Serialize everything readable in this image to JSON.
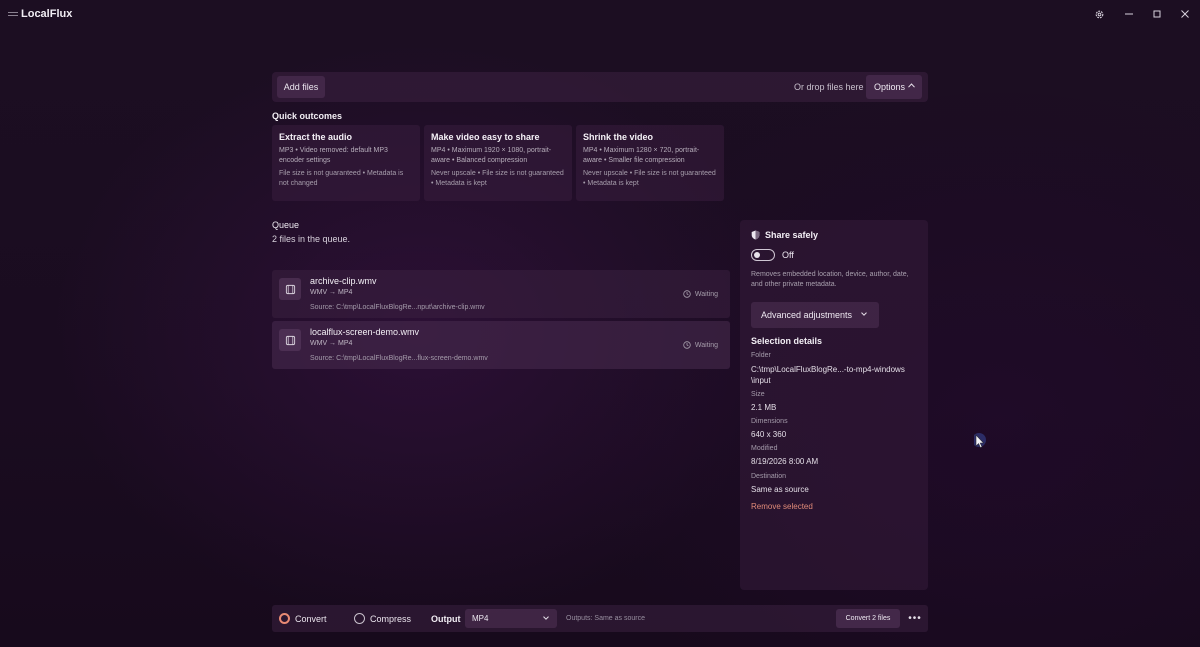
{
  "window": {
    "title": "LocalFlux",
    "icons": {
      "app": "app-icon",
      "settings": "gear-icon",
      "minimize": "minimize-icon",
      "maximize": "maximize-icon",
      "close": "close-icon"
    }
  },
  "topbar": {
    "add_files_label": "Add files",
    "drop_text": "Or drop files here",
    "options_label": "Options"
  },
  "quick_outcomes": {
    "title": "Quick outcomes",
    "cards": [
      {
        "title": "Extract the audio",
        "desc": "MP3 • Video removed: default MP3 encoder settings",
        "note": "File size is not guaranteed • Metadata is not changed"
      },
      {
        "title": "Make video easy to share",
        "desc": "MP4 • Maximum 1920 × 1080, portrait-aware • Balanced compression",
        "note": "Never upscale • File size is not guaranteed • Metadata is kept"
      },
      {
        "title": "Shrink the video",
        "desc": "MP4 • Maximum 1280 × 720, portrait-aware • Smaller file compression",
        "note": "Never upscale • File size is not guaranteed • Metadata is kept"
      }
    ]
  },
  "queue": {
    "title": "Queue",
    "count_text": "2 files in the queue.",
    "items": [
      {
        "name": "archive-clip.wmv",
        "formats": "WMV → MP4",
        "source": "Source: C:\\tmp\\LocalFluxBlogRe...nput\\archive-clip.wmv",
        "status": "Waiting"
      },
      {
        "name": "localflux-screen-demo.wmv",
        "formats": "WMV → MP4",
        "source": "Source: C:\\tmp\\LocalFluxBlogRe...flux-screen-demo.wmv",
        "status": "Waiting"
      }
    ]
  },
  "panel": {
    "share_title": "Share safely",
    "toggle_state": "Off",
    "share_desc": "Removes embedded location, device, author, date, and other private metadata.",
    "advanced_label": "Advanced adjustments",
    "details_title": "Selection details",
    "details": [
      {
        "label": "Folder",
        "value": "C:\\tmp\\LocalFluxBlogRe...-to-mp4-windows \\input"
      },
      {
        "label": "Size",
        "value": "2.1 MB"
      },
      {
        "label": "Dimensions",
        "value": "640 x 360"
      },
      {
        "label": "Modified",
        "value": "8/19/2026 8:00 AM"
      },
      {
        "label": "Destination",
        "value": "Same as source"
      }
    ],
    "remove_label": "Remove selected"
  },
  "bottombar": {
    "mode_convert": "Convert",
    "mode_compress": "Compress",
    "output_label": "Output",
    "output_value": "MP4",
    "output_hint": "Outputs: Same as source",
    "convert_button": "Convert 2 files",
    "more_label": "•••"
  },
  "colors": {
    "accent": "#e88a74",
    "link": "#e08a78",
    "background": "#1a0d1f"
  }
}
